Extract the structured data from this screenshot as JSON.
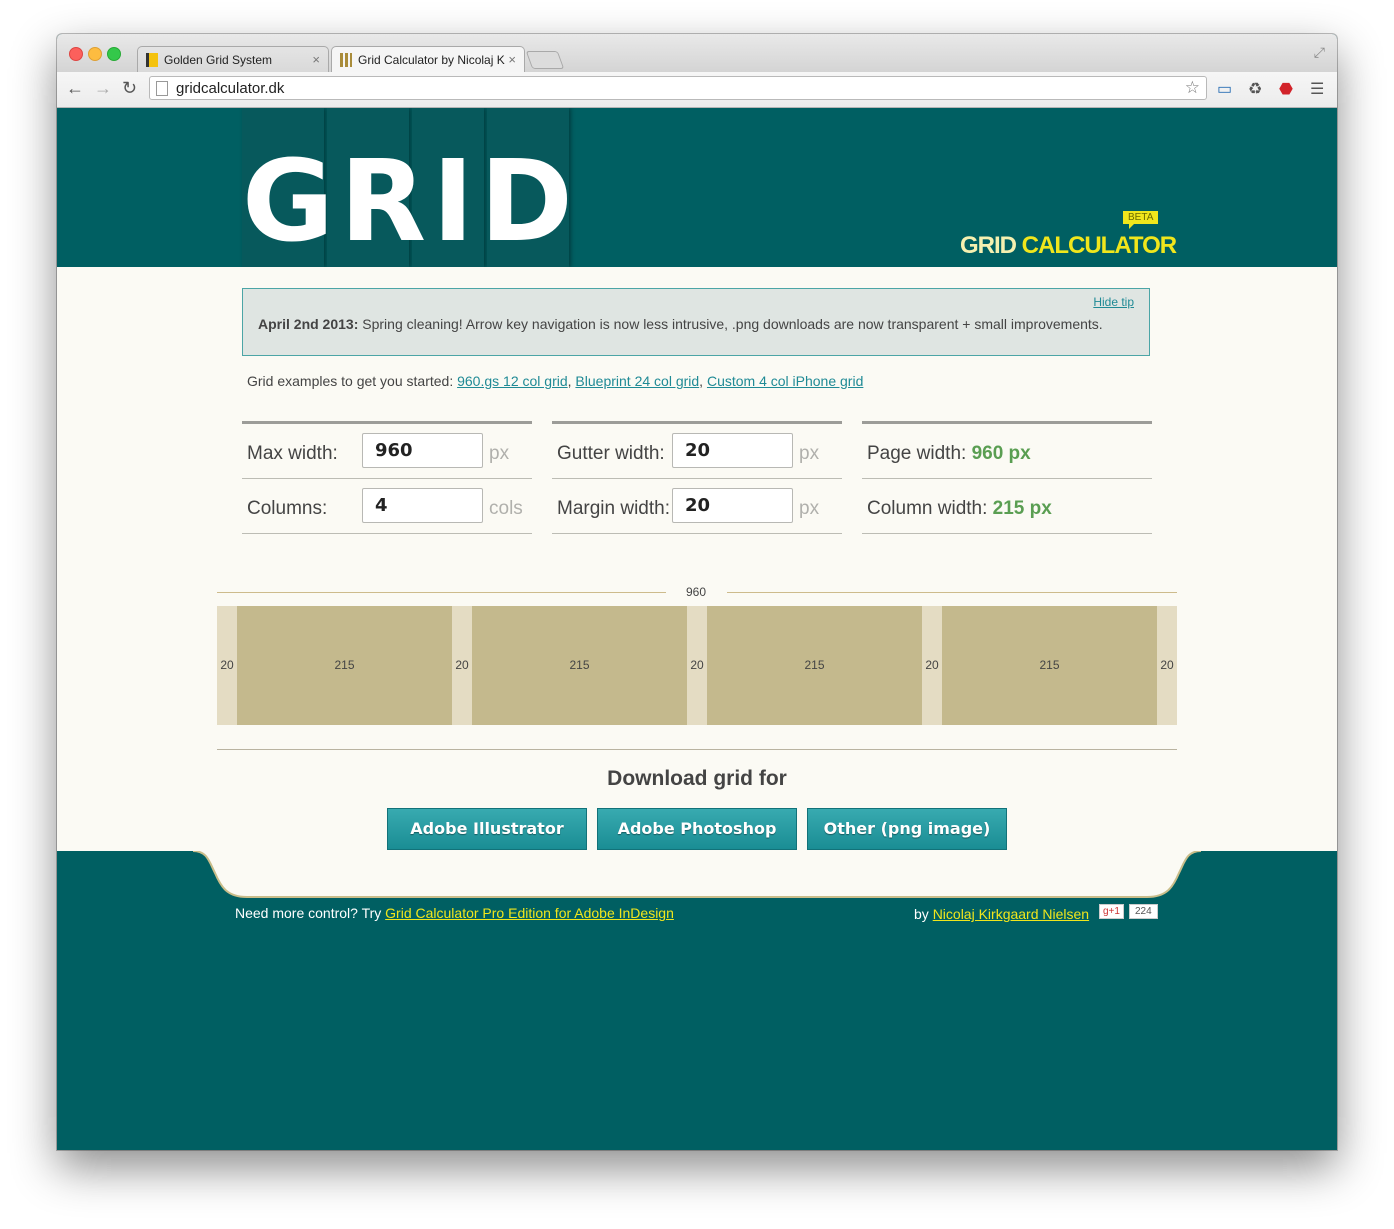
{
  "browser": {
    "tabs": [
      {
        "title": "Golden Grid System"
      },
      {
        "title": "Grid Calculator by Nicolaj K"
      }
    ],
    "url": "gridcalculator.dk"
  },
  "header": {
    "logo_word": "GRID",
    "brand_part1": "GRID",
    "brand_part2": "CALCULATOR",
    "badge": "BETA"
  },
  "tip": {
    "hide_label": "Hide tip",
    "date": "April 2nd 2013:",
    "message": " Spring cleaning! Arrow key navigation is now less intrusive, .png downloads are now transparent + small improvements."
  },
  "examples": {
    "intro": "Grid examples to get you started: ",
    "links": [
      "960.gs 12 col grid",
      "Blueprint 24 col grid",
      "Custom 4 col iPhone grid"
    ]
  },
  "form": {
    "max_width": {
      "label": "Max width:",
      "value": "960",
      "unit": "px"
    },
    "columns": {
      "label": "Columns:",
      "value": "4",
      "unit": "cols"
    },
    "gutter_width": {
      "label": "Gutter width:",
      "value": "20",
      "unit": "px"
    },
    "margin_width": {
      "label": "Margin width:",
      "value": "20",
      "unit": "px"
    },
    "page_width": {
      "label": "Page width: ",
      "value": "960 px"
    },
    "column_width": {
      "label": "Column width: ",
      "value": "215 px"
    }
  },
  "diagram": {
    "total": "960",
    "margin": "20",
    "gutter": "20",
    "columns": [
      "215",
      "215",
      "215",
      "215"
    ]
  },
  "download": {
    "title": "Download grid for",
    "buttons": [
      "Adobe Illustrator",
      "Adobe Photoshop",
      "Other (png image)"
    ]
  },
  "footer": {
    "more_control": "Need more control? Try ",
    "pro_link": "Grid Calculator Pro Edition for Adobe InDesign",
    "by": "by ",
    "author_link": "Nicolaj Kirkgaard Nielsen",
    "gplus_label": "g+1",
    "gplus_count": "224"
  }
}
